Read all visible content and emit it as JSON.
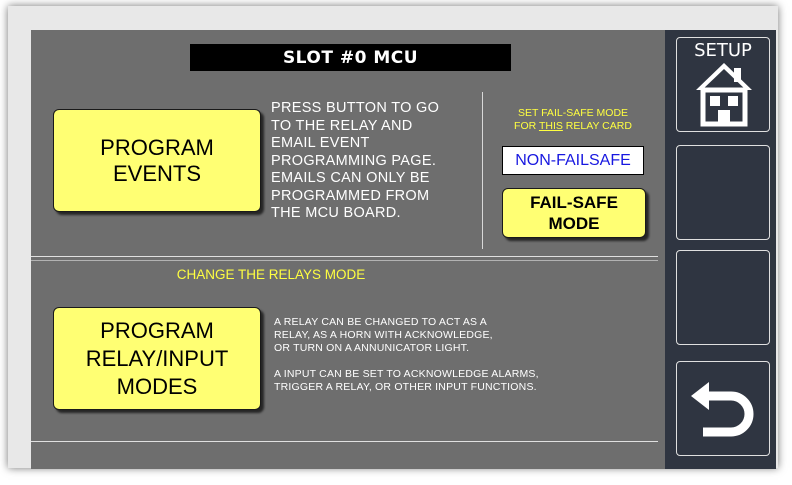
{
  "header": {
    "title": "SLOT #0 MCU"
  },
  "events": {
    "button_line1": "PROGRAM",
    "button_line2": "EVENTS",
    "description": "PRESS BUTTON TO GO\nTO THE RELAY AND\nEMAIL EVENT\nPROGRAMMING PAGE.\nEMAILS CAN  ONLY BE\nPROGRAMMED FROM\nTHE MCU BOARD."
  },
  "failsafe": {
    "label_line1": "SET FAIL-SAFE MODE",
    "label_prefix": "FOR ",
    "label_emph": "THIS",
    "label_suffix": " RELAY CARD",
    "current_mode": "NON-FAILSAFE",
    "button_line1": "FAIL-SAFE",
    "button_line2": "MODE"
  },
  "relays": {
    "section_title": "CHANGE THE RELAYS MODE",
    "button_line1": "PROGRAM",
    "button_line2": "RELAY/INPUT",
    "button_line3": "MODES",
    "description": "A RELAY CAN BE CHANGED TO ACT AS A\nRELAY, AS A HORN WITH ACKNOWLEDGE,\nOR TURN ON A ANNUNICATOR LIGHT.\n\nA INPUT CAN BE SET TO ACKNOWLEDGE ALARMS,\nTRIGGER A RELAY, OR OTHER INPUT FUNCTIONS."
  },
  "sidebar": {
    "setup_label": "SETUP",
    "setup_icon": "home-icon",
    "back_icon": "back-arrow-icon"
  },
  "colors": {
    "panel": "#6e6e6e",
    "sidebar": "#2f3541",
    "button": "#ffff73",
    "accent_text": "#ffff40",
    "mode_text": "#1818e0"
  }
}
